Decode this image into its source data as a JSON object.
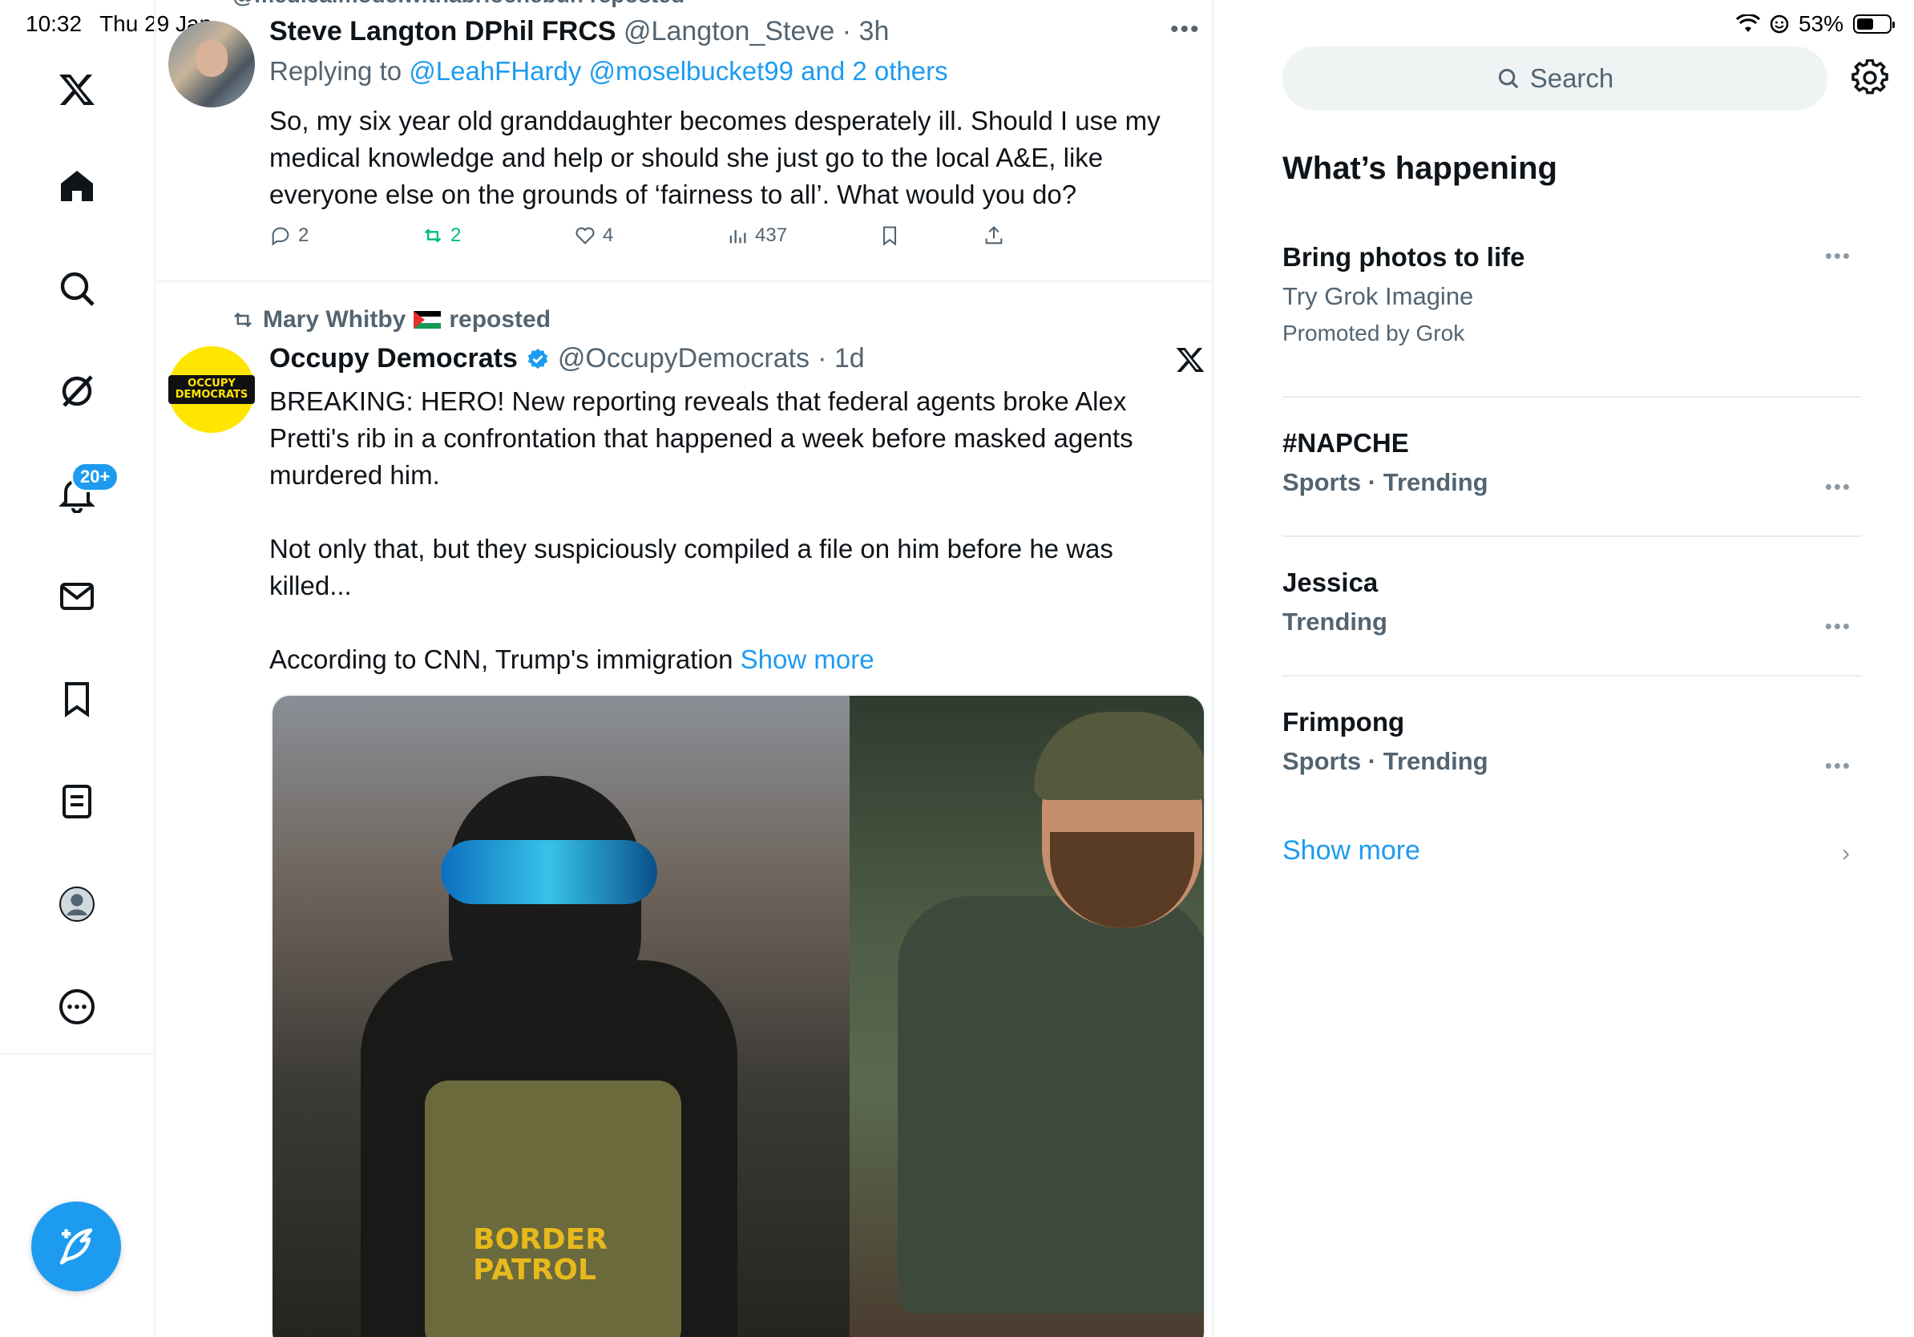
{
  "status": {
    "time": "10:32",
    "date": "Thu 29 Jan",
    "battery": "53%",
    "battery_level": 0.53
  },
  "nav": {
    "notifications_badge": "20+"
  },
  "timeline": {
    "top_repost_text": "@medicalmodelwithabrioche​bun reposted",
    "tweet1": {
      "name": "Steve Langton DPhil FRCS",
      "handle": "@Langton_Steve",
      "time": "· 3h",
      "replying_prefix": "Replying to ",
      "replying_to": "@LeahFHardy @moselbucket99 and 2 others",
      "text": "So, my six year old granddaughter becomes desperately ill. Should I use my medical knowledge and help or should she just go to the local A&E, like everyone else on the grounds of ‘fairness to all’. What would you do?",
      "replies": "2",
      "reposts": "2",
      "likes": "4",
      "views": "437"
    },
    "tweet2": {
      "repost_by": "Mary Whitby",
      "repost_suffix": "reposted",
      "name": "Occupy Democrats",
      "handle": "@OccupyDemocrats",
      "time": "· 1d",
      "avatar_text": "OCCUPY DEMOCRATS",
      "text": "BREAKING: HERO! New reporting reveals that federal agents broke Alex Pretti's rib in a confrontation that happened a week before masked agents murdered him.\n\nNot only that, but they suspiciously compiled a file on him before he was killed...\n\nAccording to CNN, Trump's immigration ",
      "show_more": "Show more",
      "image_vest_text": "BORDER PATROL"
    }
  },
  "sidebar": {
    "search_placeholder": "Search",
    "title": "What’s happening",
    "trends": [
      {
        "title": "Bring photos to life",
        "sub": "Try Grok Imagine",
        "promo": "Promoted by Grok"
      },
      {
        "title": "#NAPCHE",
        "sub": "Sports · Trending"
      },
      {
        "title": "Jessica",
        "sub": "Trending"
      },
      {
        "title": "Frimpong",
        "sub": "Sports · Trending"
      }
    ],
    "show_more": "Show more"
  },
  "colors": {
    "accent": "#1d9bf0",
    "repost_green": "#00ba7c",
    "muted": "#536471"
  }
}
